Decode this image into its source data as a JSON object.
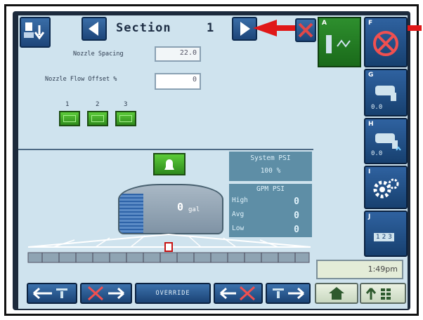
{
  "header": {
    "title": "Section",
    "section_number": "1"
  },
  "settings": {
    "nozzle_spacing_label": "Nozzle Spacing",
    "nozzle_spacing_value": "22.0",
    "nozzle_flow_offset_label": "Nozzle Flow Offset %",
    "nozzle_flow_offset_value": "0"
  },
  "sections": [
    "1",
    "2",
    "3"
  ],
  "system": {
    "label": "System PSI",
    "value": "100 %",
    "table_header": "GPM PSI",
    "rows": [
      {
        "label": "High",
        "value": "0"
      },
      {
        "label": "Avg",
        "value": "0"
      },
      {
        "label": "Low",
        "value": "0"
      }
    ]
  },
  "tank": {
    "amount": "0",
    "unit": "gal"
  },
  "side_keys": [
    "A",
    "F",
    "G",
    "H",
    "I",
    "J"
  ],
  "side_values": {
    "g": "0.0",
    "h": "0.0"
  },
  "time": "1:49pm",
  "bottom": {
    "override_label": "OVERRIDE"
  },
  "numpad_label": "1 2 3",
  "colors": {
    "screen_bg": "#cfe3ee",
    "accent_red": "#e01818",
    "button_blue": "#1d4579",
    "active_green": "#2f8a1c"
  }
}
